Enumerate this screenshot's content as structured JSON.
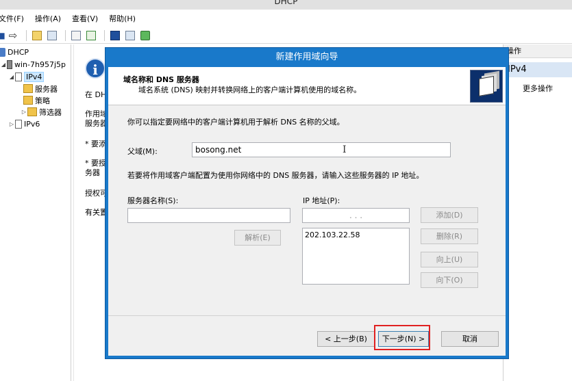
{
  "window": {
    "title": "DHCP"
  },
  "menu": [
    "文件(F)",
    "操作(A)",
    "查看(V)",
    "帮助(H)"
  ],
  "toolbar": {
    "icons": [
      "back-icon",
      "forward-icon",
      "up-folder-icon",
      "show-hide-tree-icon",
      "properties-icon",
      "refresh-icon",
      "help-icon",
      "view-icon",
      "monitor-icon"
    ]
  },
  "tree": {
    "items": [
      {
        "label": "DHCP",
        "icon": "dhcp-icon"
      },
      {
        "label": "win-7h957j5p",
        "icon": "server-icon"
      },
      {
        "label": "IPv4",
        "icon": "ipv4-icon",
        "selected": true
      },
      {
        "label": "服务器",
        "icon": "folder-icon"
      },
      {
        "label": "策略",
        "icon": "policy-icon"
      },
      {
        "label": "筛选器",
        "icon": "filter-icon"
      },
      {
        "label": "IPv6",
        "icon": "ipv6-icon"
      }
    ]
  },
  "center": {
    "lines": [
      "在 DH",
      "作用域",
      "服务器",
      "* 要添",
      "* 要授",
      "务器",
      "授权可",
      "有关置"
    ]
  },
  "actions": {
    "header": "操作",
    "selected": "IPv4",
    "more": "更多操作"
  },
  "dialog": {
    "title": "新建作用域向导",
    "heading": "域名称和 DNS 服务器",
    "subheading": "域名系统 (DNS) 映射并转换网络上的客户端计算机使用的域名称。",
    "intro": "你可以指定要网络中的客户端计算机用于解析 DNS 名称的父域。",
    "parent_label": "父域(M):",
    "parent_value": "bosong.net",
    "dns_note": "若要将作用域客户端配置为使用你网络中的 DNS 服务器，请输入这些服务器的 IP 地址。",
    "server_label": "服务器名称(S):",
    "server_value": "",
    "ip_label": "IP 地址(P):",
    "ip_value": ".        .        .",
    "resolve_button": "解析(E)",
    "ip_list": [
      "202.103.22.58"
    ],
    "add_button": "添加(D)",
    "remove_button": "删除(R)",
    "up_button": "向上(U)",
    "down_button": "向下(O)",
    "back_button": "< 上一步(B)",
    "next_button": "下一步(N) >",
    "cancel_button": "取消"
  }
}
